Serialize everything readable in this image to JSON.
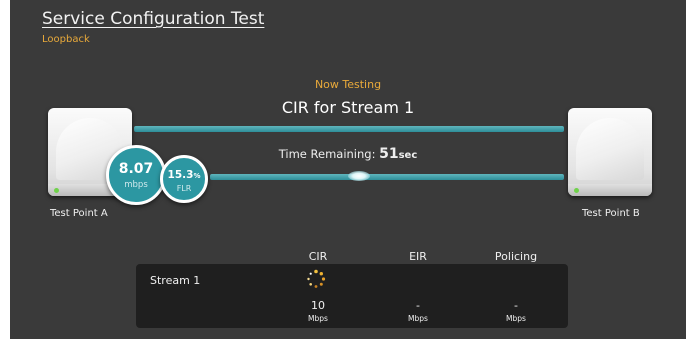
{
  "header": {
    "title": "Service Configuration Test",
    "subtitle": "Loopback"
  },
  "status": {
    "now_testing_label": "Now Testing",
    "test_name": "CIR for Stream 1",
    "time_remaining_label": "Time Remaining:",
    "time_remaining_value": "51",
    "time_remaining_unit": "sec"
  },
  "devices": {
    "a_label": "Test Point A",
    "b_label": "Test Point B"
  },
  "metrics": {
    "rate_value": "8.07",
    "rate_unit": "mbps",
    "flr_value": "15.3",
    "flr_percent": "%",
    "flr_label": "FLR"
  },
  "results": {
    "columns": [
      "CIR",
      "EIR",
      "Policing"
    ],
    "stream_label": "Stream 1",
    "cir_value": "10",
    "cir_unit": "Mbps",
    "eir_value": "-",
    "eir_unit": "Mbps",
    "policing_value": "-",
    "policing_unit": "Mbps"
  },
  "icons": {
    "spinner": "loading-spinner-icon",
    "status_led": "status-led-icon"
  },
  "colors": {
    "accent_teal": "#2c97a2",
    "link_line": "#4aa8b2",
    "label_orange": "#e8a93a",
    "background": "#3a3a3a",
    "panel": "#1f1f1f",
    "led_green": "#6fd24a"
  }
}
